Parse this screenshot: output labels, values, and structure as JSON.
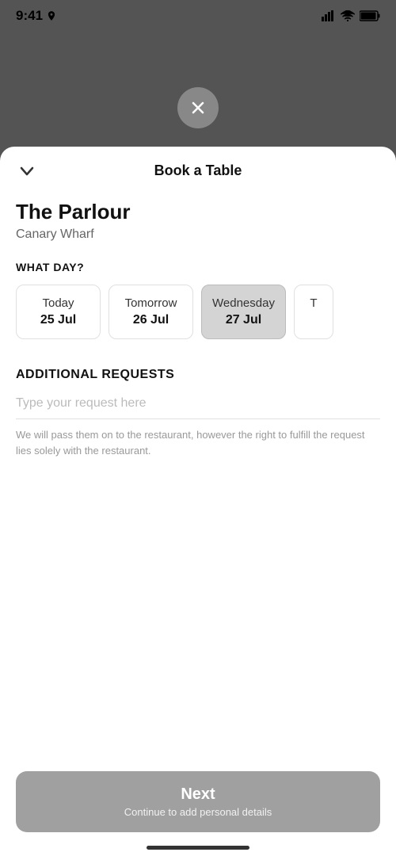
{
  "statusBar": {
    "time": "9:41",
    "timeSuffix": ""
  },
  "closeButton": {
    "label": "×"
  },
  "sheet": {
    "title": "Book a Table",
    "chevronLabel": "chevron-down"
  },
  "restaurant": {
    "name": "The Parlour",
    "location": "Canary Wharf"
  },
  "daySection": {
    "label": "WHAT DAY?"
  },
  "days": [
    {
      "dayName": "Today",
      "date": "25 Jul",
      "selected": false
    },
    {
      "dayName": "Tomorrow",
      "date": "26 Jul",
      "selected": false
    },
    {
      "dayName": "Wednesday",
      "date": "27 Jul",
      "selected": true
    },
    {
      "dayName": "T",
      "date": "",
      "selected": false
    }
  ],
  "additionalRequests": {
    "label": "ADDITIONAL REQUESTS",
    "placeholder": "Type your request here",
    "note": "We will pass them on to the restaurant, however the right to fulfill the request lies solely with the restaurant."
  },
  "footer": {
    "nextLabel": "Next",
    "nextSublabel": "Continue to add personal details"
  }
}
